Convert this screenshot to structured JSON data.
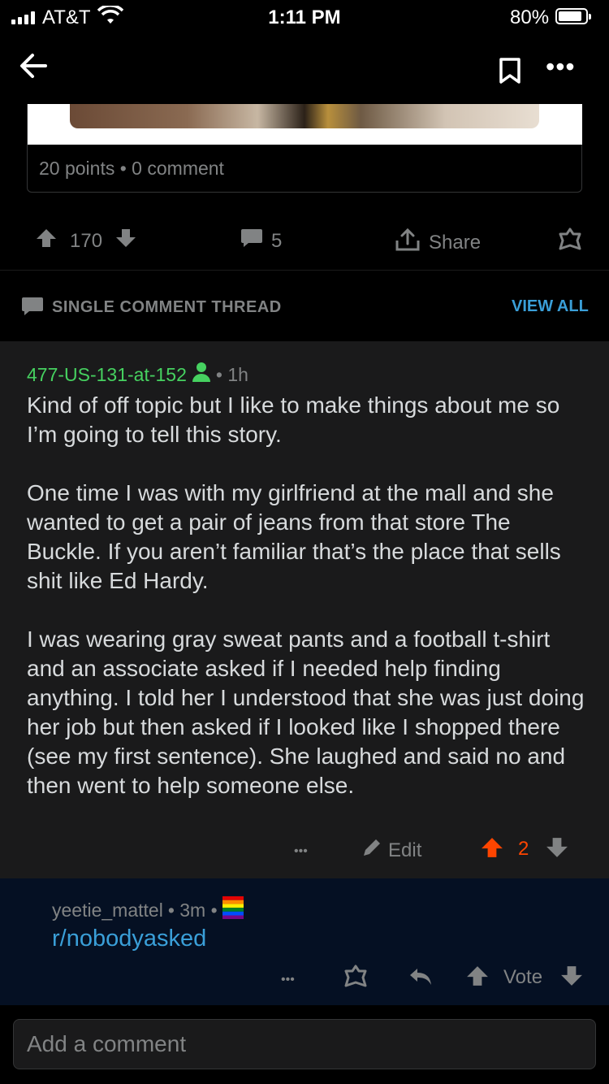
{
  "status_bar": {
    "carrier": "AT&T",
    "time": "1:11 PM",
    "battery": "80%"
  },
  "card": {
    "meta": "20 points • 0 comment"
  },
  "actions": {
    "upvotes": "170",
    "comments": "5",
    "share": "Share"
  },
  "thread": {
    "label": "SINGLE COMMENT THREAD",
    "view_all": "VIEW ALL"
  },
  "comment": {
    "author": "477-US-131-at-152",
    "age": "• 1h",
    "paragraphs": [
      "Kind of off topic but I like to make things about me so I’m going to tell this story.",
      "One time I was with my girlfriend at the mall and she wanted to get a pair of jeans from that store The Buckle. If you aren’t familiar that’s the place that sells shit like Ed Hardy.",
      "I was wearing gray sweat pants and a football t-shirt and an associate asked if I needed help finding anything. I told her I understood that she was just doing her job but then asked if I looked like I shopped there (see my first sentence). She laughed and said no and then went to help someone else."
    ],
    "more": "•••",
    "edit": "Edit",
    "score": "2",
    "upvote_color": "#ff4500"
  },
  "reply": {
    "author": "yeetie_mattel",
    "age": "• 3m •",
    "body": "r/nobodyasked",
    "more": "•••",
    "vote": "Vote"
  },
  "composer": {
    "placeholder": "Add a comment"
  },
  "colors": {
    "link": "#3a9fd8",
    "author": "#46d160",
    "reply_bg": "#051023",
    "comment_bg": "#1a1a1b"
  }
}
